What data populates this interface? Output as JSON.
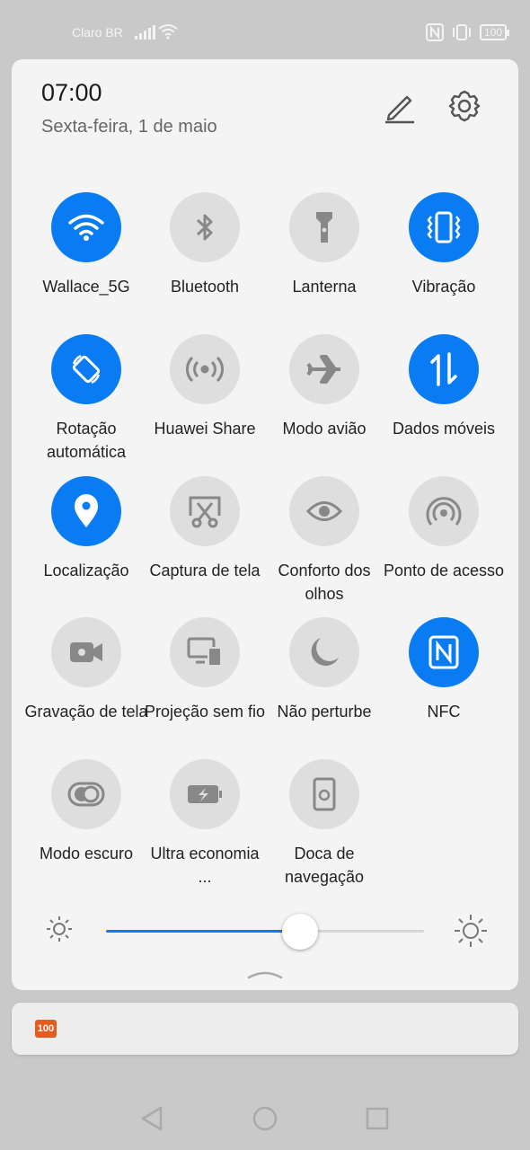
{
  "status_bar": {
    "carrier": "Claro BR",
    "battery": "100"
  },
  "header": {
    "time": "07:00",
    "date": "Sexta-feira, 1 de maio"
  },
  "tiles": [
    {
      "label": "Wallace_5G",
      "icon": "wifi-icon",
      "on": true
    },
    {
      "label": "Bluetooth",
      "icon": "bluetooth-icon",
      "on": false
    },
    {
      "label": "Lanterna",
      "icon": "flashlight-icon",
      "on": false
    },
    {
      "label": "Vibração",
      "icon": "vibration-icon",
      "on": true
    },
    {
      "label": "Rotação automática",
      "icon": "rotation-icon",
      "on": true
    },
    {
      "label": "Huawei Share",
      "icon": "huawei-share-icon",
      "on": false
    },
    {
      "label": "Modo avião",
      "icon": "airplane-icon",
      "on": false
    },
    {
      "label": "Dados móveis",
      "icon": "mobile-data-icon",
      "on": true
    },
    {
      "label": "Localização",
      "icon": "location-icon",
      "on": true
    },
    {
      "label": "Captura de tela",
      "icon": "screenshot-icon",
      "on": false
    },
    {
      "label": "Conforto dos olhos",
      "icon": "eye-icon",
      "on": false
    },
    {
      "label": "Ponto de acesso",
      "icon": "hotspot-icon",
      "on": false
    },
    {
      "label": "Gravação de tela",
      "icon": "screen-record-icon",
      "on": false
    },
    {
      "label": "Projeção sem fio",
      "icon": "wireless-projection-icon",
      "on": false
    },
    {
      "label": "Não perturbe",
      "icon": "moon-icon",
      "on": false
    },
    {
      "label": "NFC",
      "icon": "nfc-icon",
      "on": true
    },
    {
      "label": "Modo escuro",
      "icon": "dark-mode-icon",
      "on": false
    },
    {
      "label": "Ultra economia ...",
      "icon": "battery-saver-icon",
      "on": false
    },
    {
      "label": "Doca de navegação",
      "icon": "nav-dock-icon",
      "on": false
    }
  ],
  "brightness": {
    "level": 0.61
  },
  "notification": {
    "app_badge": "100"
  },
  "colors": {
    "accent": "#0a7cf3",
    "tile_off": "#dedede",
    "panel": "#f4f4f4"
  }
}
